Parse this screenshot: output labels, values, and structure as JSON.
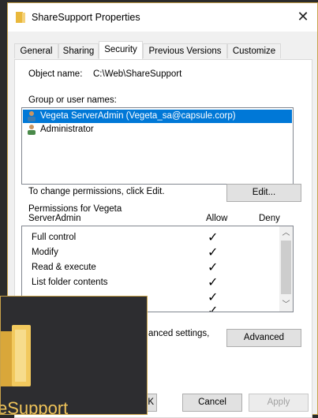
{
  "window": {
    "title": "ShareSupport Properties",
    "close_glyph": "✕"
  },
  "tabs": [
    {
      "label": "General"
    },
    {
      "label": "Sharing"
    },
    {
      "label": "Security"
    },
    {
      "label": "Previous Versions"
    },
    {
      "label": "Customize"
    }
  ],
  "security": {
    "object_name_label": "Object name:",
    "object_name_value": "C:\\Web\\ShareSupport",
    "group_label": "Group or user names:",
    "users": [
      {
        "name": "Vegeta ServerAdmin (Vegeta_sa@capsule.corp)",
        "selected": true
      },
      {
        "name": "Administrator",
        "selected": false
      }
    ],
    "change_hint": "To change permissions, click Edit.",
    "edit_button": "Edit...",
    "permissions_for_line1": "Permissions for Vegeta",
    "permissions_for_line2": "ServerAdmin",
    "allow_header": "Allow",
    "deny_header": "Deny",
    "permissions": [
      {
        "name": "Full control",
        "allow": true
      },
      {
        "name": "Modify",
        "allow": true
      },
      {
        "name": "Read & execute",
        "allow": true
      },
      {
        "name": "List folder contents",
        "allow": true
      },
      {
        "name": "",
        "allow": true
      },
      {
        "name": "",
        "allow": true
      }
    ],
    "advanced_hint": "anced settings,",
    "advanced_button": "Advanced"
  },
  "footer": {
    "ok_fragment": "K",
    "cancel_button": "Cancel",
    "apply_button": "Apply"
  },
  "overlay": {
    "text": "eSupport"
  },
  "colors": {
    "selection": "#0078d7",
    "accent": "#c8a24a",
    "folder": "#f0c45a"
  }
}
